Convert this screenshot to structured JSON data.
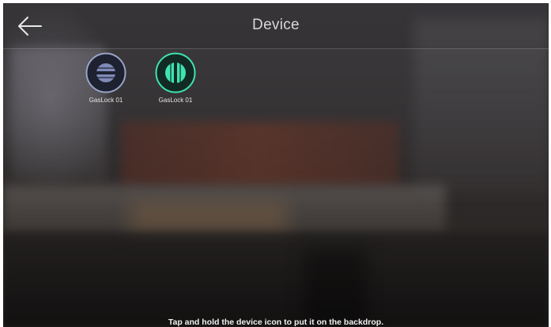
{
  "header": {
    "title": "Device",
    "back_icon": "arrow-left-icon"
  },
  "devices": [
    {
      "label": "GasLock 01",
      "icon": "gas-lock-closed-icon",
      "ring_color": "#9aa3c8",
      "fill_color": "#1e2230",
      "symbol_color": "#7f8ab8"
    },
    {
      "label": "GasLock 01",
      "icon": "gas-lock-open-icon",
      "ring_color": "#3fe3b0",
      "fill_color": "#132a24",
      "symbol_color": "#3fe3b0"
    }
  ],
  "hint": "Tap and hold the device icon to put it on the backdrop."
}
